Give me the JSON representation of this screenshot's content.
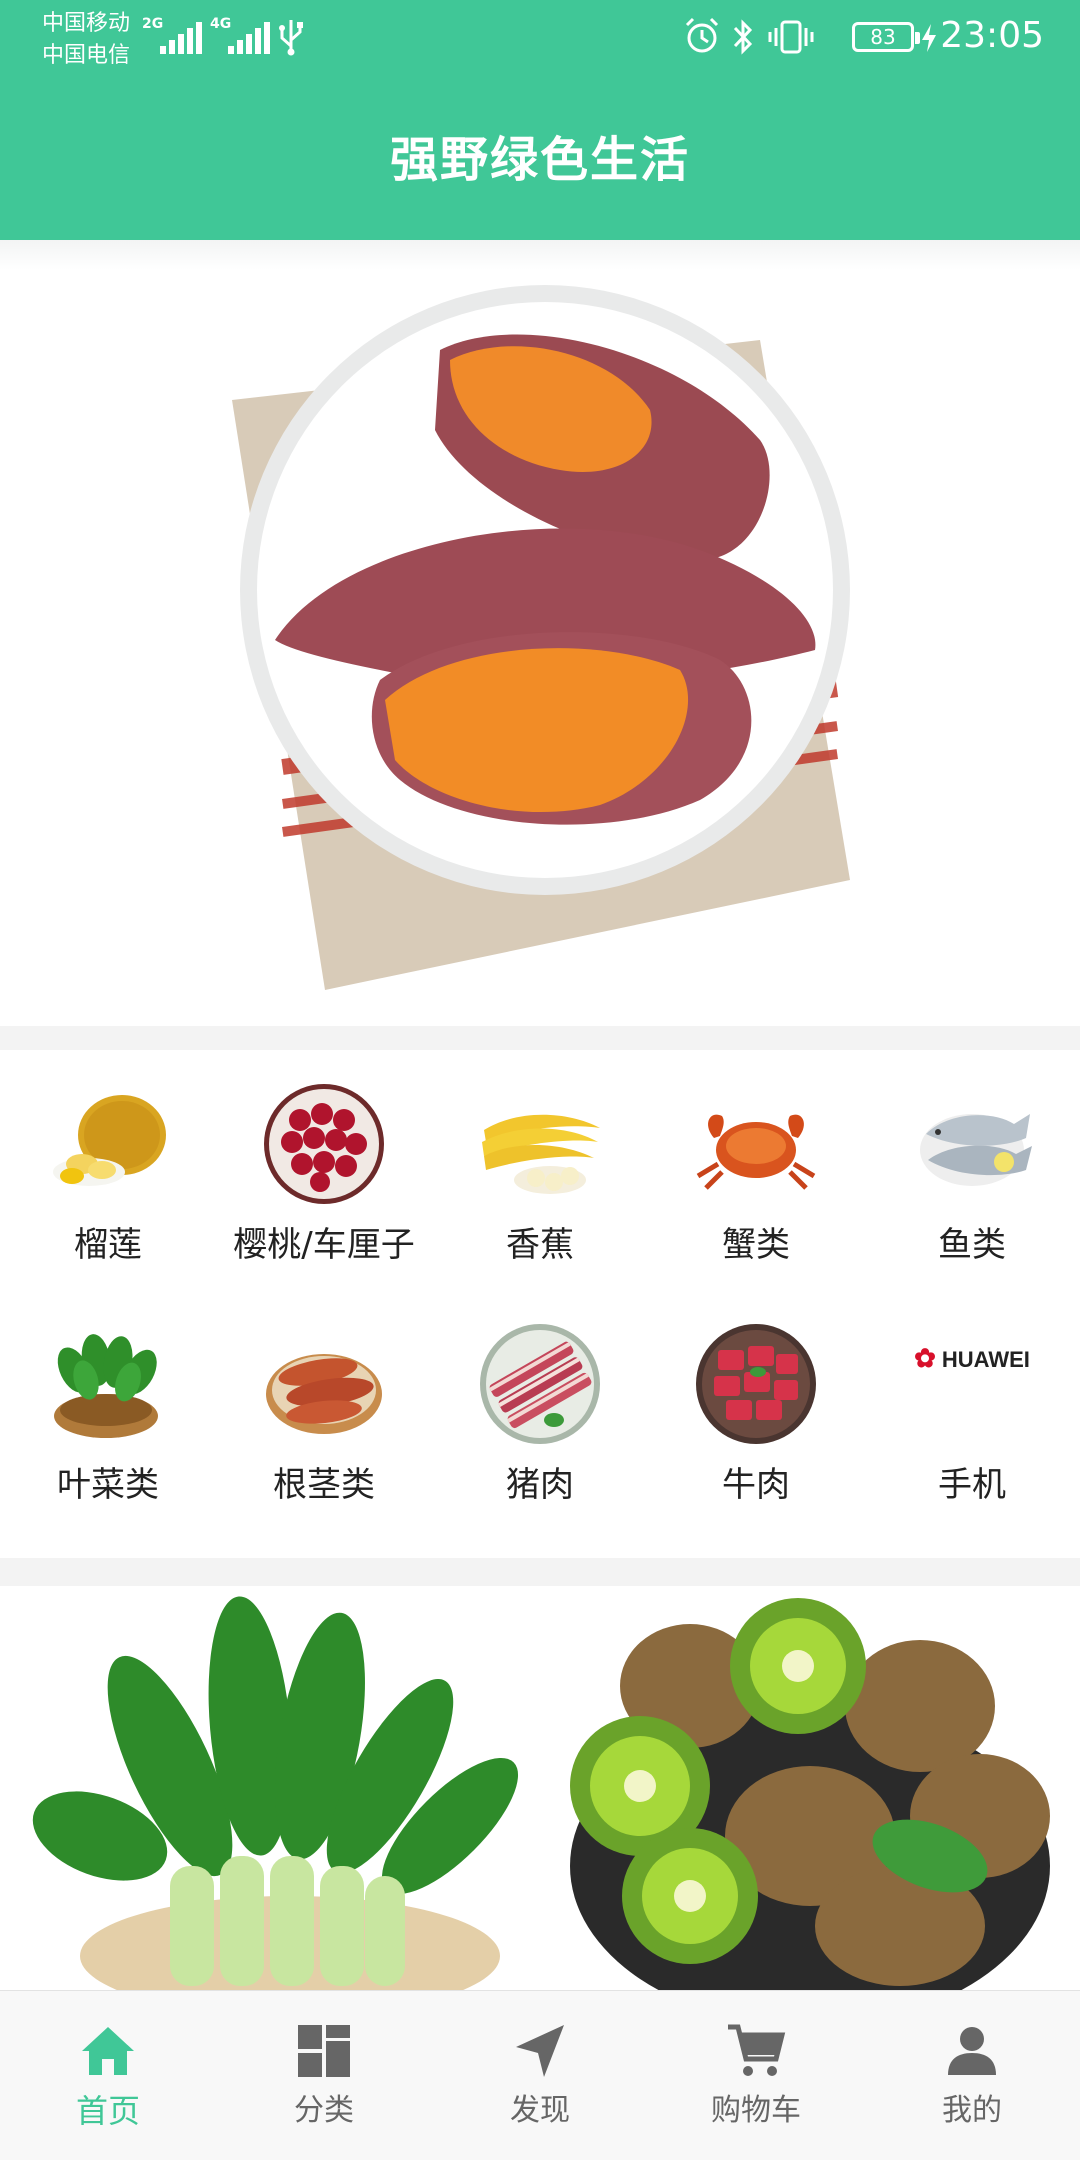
{
  "status_bar": {
    "carrier1": "中国移动",
    "carrier2": "中国电信",
    "net1": "2G",
    "net2": "4G",
    "battery": "83",
    "time": "23:05"
  },
  "header": {
    "title": "强野绿色生活"
  },
  "banner": {
    "dot_count": 8,
    "active_dot_index": 2
  },
  "categories": [
    {
      "label": "榴莲",
      "icon": "durian"
    },
    {
      "label": "樱桃/车厘子",
      "icon": "cherries"
    },
    {
      "label": "香蕉",
      "icon": "bananas"
    },
    {
      "label": "蟹类",
      "icon": "crab"
    },
    {
      "label": "鱼类",
      "icon": "fish"
    },
    {
      "label": "叶菜类",
      "icon": "leafy-greens"
    },
    {
      "label": "根茎类",
      "icon": "sweet-potatoes"
    },
    {
      "label": "猪肉",
      "icon": "pork"
    },
    {
      "label": "牛肉",
      "icon": "beef"
    },
    {
      "label": "手机",
      "icon": "huawei-logo",
      "logo_text": "HUAWEI"
    }
  ],
  "bottom_nav": [
    {
      "label": "首页",
      "icon": "home-icon",
      "active": true
    },
    {
      "label": "分类",
      "icon": "grid-icon",
      "active": false
    },
    {
      "label": "发现",
      "icon": "navigation-icon",
      "active": false
    },
    {
      "label": "购物车",
      "icon": "cart-icon",
      "active": false
    },
    {
      "label": "我的",
      "icon": "user-icon",
      "active": false
    }
  ],
  "colors": {
    "accent": "#40C797",
    "nav_inactive": "#666666"
  }
}
